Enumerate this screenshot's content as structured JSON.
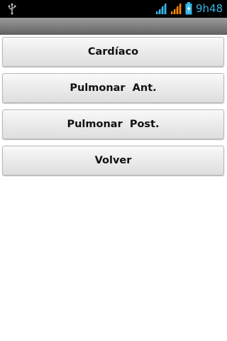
{
  "status_bar": {
    "time": "9h48",
    "icons": [
      "usb-icon",
      "signal-icon",
      "signal-icon",
      "battery-charging-icon"
    ],
    "accent_color": "#33b5e5",
    "signal_2_color": "#ff8800"
  },
  "title_bar": {
    "title": ""
  },
  "menu": {
    "buttons": [
      {
        "label": "Cardíaco"
      },
      {
        "label": "Pulmonar  Ant."
      },
      {
        "label": "Pulmonar  Post."
      },
      {
        "label": "Volver"
      }
    ]
  }
}
